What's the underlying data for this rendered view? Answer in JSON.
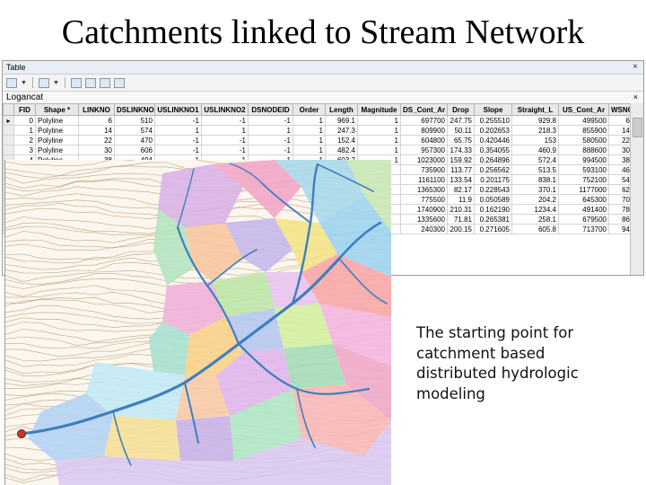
{
  "slide": {
    "title": "Catchments linked to Stream Network",
    "caption": [
      "The starting point for",
      "catchment based",
      "distributed hydrologic",
      "modeling"
    ]
  },
  "table_window": {
    "title": "Table",
    "close_glyph": "×",
    "tab_label": "Logancat",
    "tab_close_glyph": "×",
    "columns": [
      "FID",
      "Shape *",
      "LINKNO",
      "DSLINKNO",
      "USLINKNO1",
      "USLINKNO2",
      "DSNODEID",
      "Order",
      "Length",
      "Magnitude",
      "DS_Cont_Ar",
      "Drop",
      "Slope",
      "Straight_L",
      "US_Cont_Ar",
      "WSNO"
    ],
    "rows": [
      [
        "0",
        "Polyline",
        "6",
        "510",
        "-1",
        "-1",
        "-1",
        "1",
        "969.1",
        "1",
        "697700",
        "247.75",
        "0.255510",
        "929.8",
        "499500",
        "6"
      ],
      [
        "1",
        "Polyline",
        "14",
        "574",
        "1",
        "1",
        "1",
        "1",
        "247.3",
        "1",
        "809900",
        "50.11",
        "0.202653",
        "218.3",
        "855900",
        "14"
      ],
      [
        "2",
        "Polyline",
        "22",
        "470",
        "-1",
        "-1",
        "-1",
        "1",
        "152.4",
        "1",
        "604800",
        "65.75",
        "0.420446",
        "153",
        "580500",
        "22"
      ],
      [
        "3",
        "Polyline",
        "30",
        "606",
        "-1",
        "-1",
        "-1",
        "1",
        "482.4",
        "1",
        "957300",
        "174.33",
        "0.354055",
        "460.9",
        "888600",
        "30"
      ],
      [
        "4",
        "Polyline",
        "38",
        "494",
        "-1",
        "-1",
        "-1",
        "1",
        "603.7",
        "1",
        "1023000",
        "159.92",
        "0.264896",
        "572.4",
        "994500",
        "38"
      ],
      [
        "",
        "",
        "",
        "",
        "",
        "",
        "",
        "",
        "",
        "",
        "735900",
        "113.77",
        "0.256562",
        "513.5",
        "593100",
        "46"
      ],
      [
        "",
        "",
        "",
        "",
        "",
        "",
        "",
        "",
        "",
        "",
        "1161100",
        "133.54",
        "0.201175",
        "838.1",
        "752100",
        "54"
      ],
      [
        "",
        "",
        "",
        "",
        "",
        "",
        "",
        "",
        "",
        "",
        "1365300",
        "82.17",
        "0.228543",
        "370.1",
        "1177000",
        "62"
      ],
      [
        "",
        "",
        "",
        "",
        "",
        "",
        "",
        "",
        "",
        "",
        "775500",
        "11.9",
        "0.050589",
        "204.2",
        "645300",
        "70"
      ],
      [
        "",
        "",
        "",
        "",
        "",
        "",
        "",
        "",
        "",
        "",
        "1740900",
        "210.31",
        "0.162190",
        "1234.4",
        "491400",
        "78"
      ],
      [
        "",
        "",
        "",
        "",
        "",
        "",
        "",
        "",
        "",
        "",
        "1335600",
        "71.81",
        "0.265381",
        "258.1",
        "679500",
        "86"
      ],
      [
        "",
        "",
        "",
        "",
        "",
        "",
        "",
        "",
        "",
        "",
        "240300",
        "200.15",
        "0.271605",
        "605.8",
        "713700",
        "94"
      ]
    ]
  },
  "colors": {
    "stream": "#3d7fbf",
    "outlet": "#c0392b",
    "contour": "#b08a55"
  }
}
